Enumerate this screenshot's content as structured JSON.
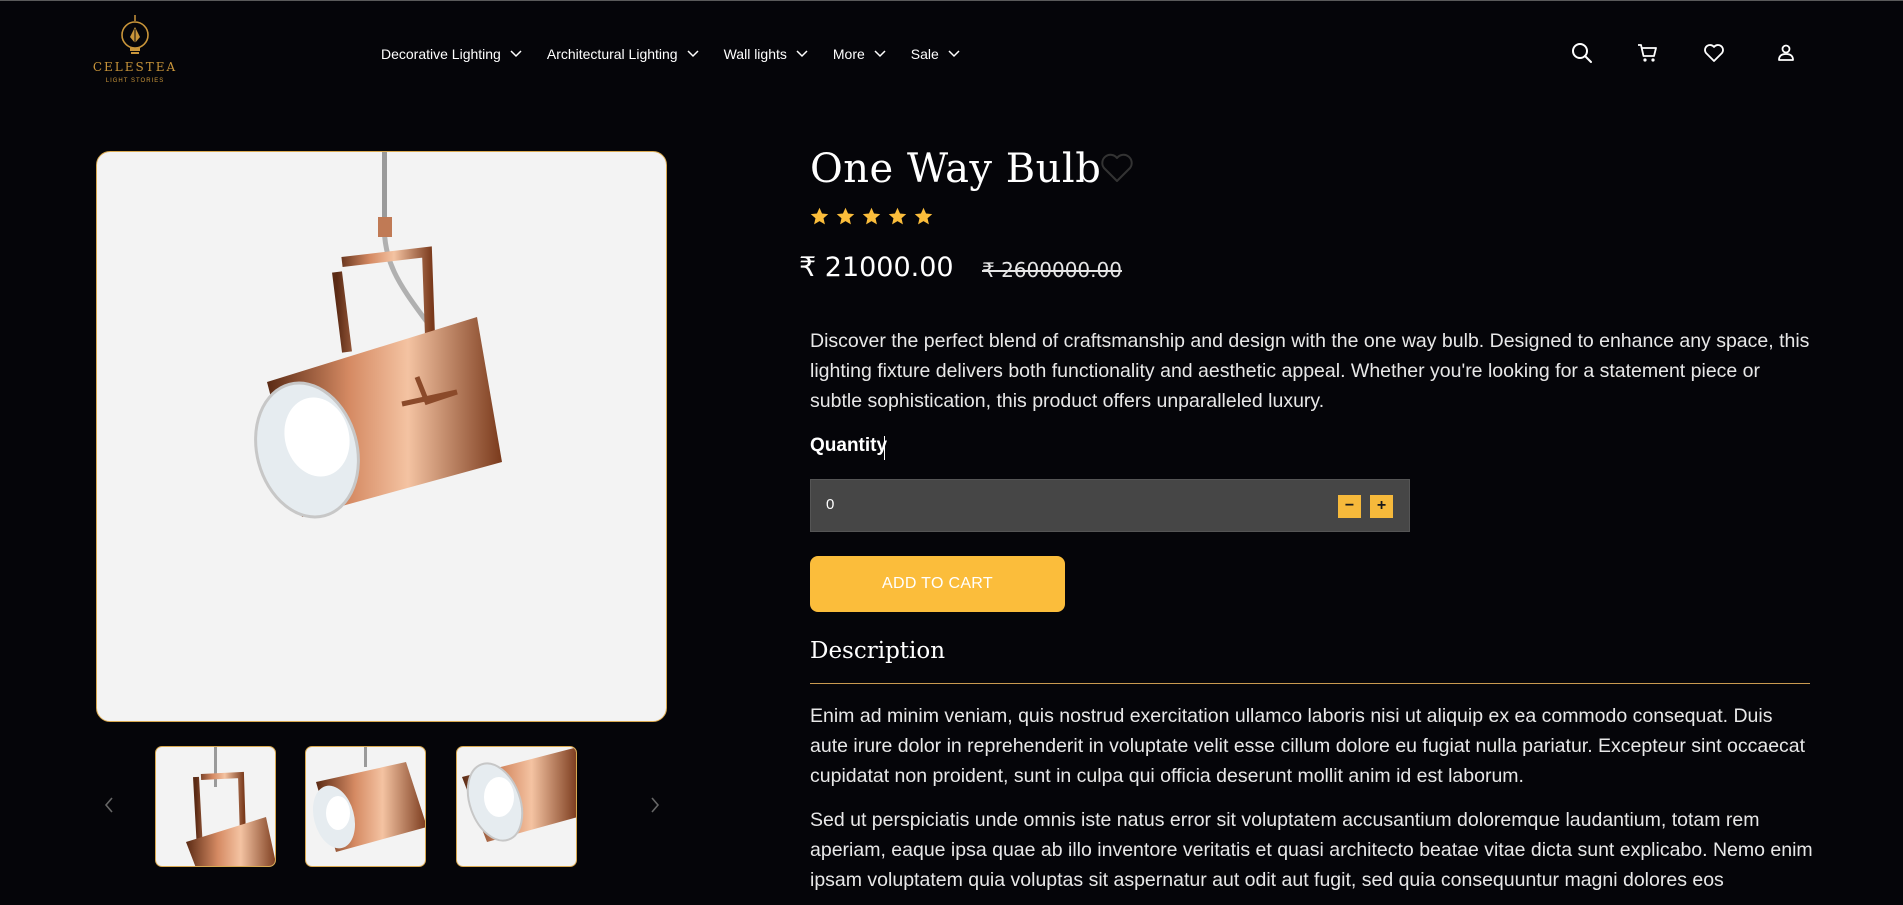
{
  "brand": {
    "name": "CELESTEA",
    "tagline": "LIGHT STORIES",
    "accent": "#fbbd3b"
  },
  "nav": {
    "items": [
      {
        "label": "Decorative Lighting"
      },
      {
        "label": "Architectural Lighting"
      },
      {
        "label": "Wall lights"
      },
      {
        "label": "More"
      },
      {
        "label": "Sale"
      }
    ]
  },
  "header_icons": [
    "search-icon",
    "cart-icon",
    "heart-icon",
    "user-icon"
  ],
  "gallery": {
    "thumbnail_count": 3,
    "prev_icon": "chevron-left-icon",
    "next_icon": "chevron-right-icon"
  },
  "product": {
    "title": "One Way Bulb",
    "rating": 5,
    "rating_max": 5,
    "price": "₹ 21000.00",
    "old_price": "₹ 2600000.00",
    "lead": "Discover the perfect blend of craftsmanship and design with the one way bulb. Designed to enhance any space, this lighting fixture delivers both functionality and aesthetic appeal. Whether you're looking for a statement piece or subtle sophistication, this product offers unparalleled luxury."
  },
  "quantity": {
    "label": "Quantity",
    "value": "0",
    "decrement": "−",
    "increment": "+"
  },
  "cart": {
    "add_label": "ADD TO CART"
  },
  "description": {
    "heading": "Description",
    "paragraphs": [
      "Enim ad minim veniam, quis nostrud exercitation ullamco laboris nisi ut aliquip ex ea commodo consequat. Duis aute irure dolor in reprehenderit in voluptate velit esse cillum dolore eu fugiat nulla pariatur. Excepteur sint occaecat cupidatat non proident, sunt in culpa qui officia deserunt mollit anim id est laborum.",
      "Sed ut perspiciatis unde omnis iste natus error sit voluptatem accusantium doloremque laudantium, totam rem aperiam, eaque ipsa quae ab illo inventore veritatis et quasi architecto beatae vitae dicta sunt explicabo. Nemo enim ipsam voluptatem quia voluptas sit aspernatur aut odit aut fugit, sed quia consequuntur magni dolores eos"
    ]
  }
}
